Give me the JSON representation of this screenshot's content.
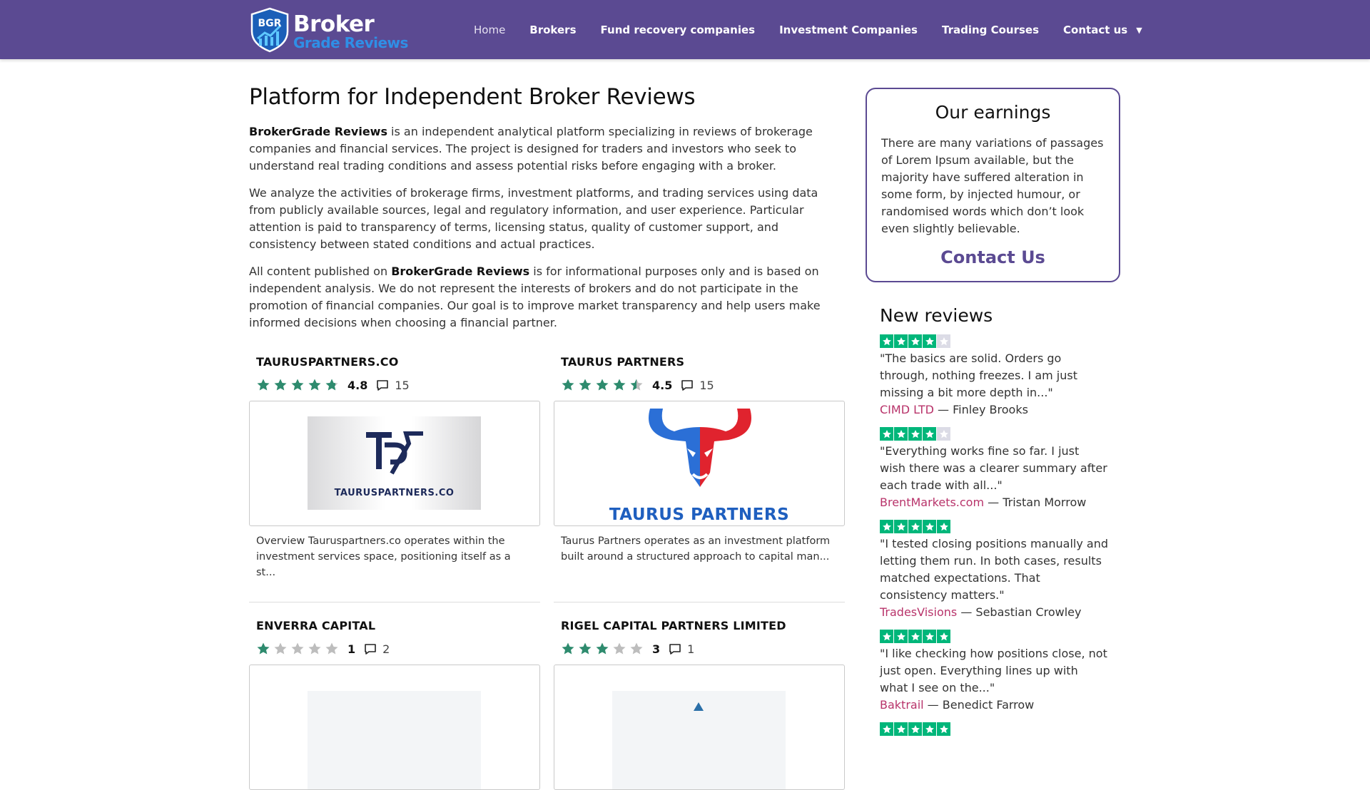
{
  "header": {
    "logo": {
      "badge": "BGR",
      "line1": "Broker",
      "line2": "Grade Reviews"
    },
    "nav": [
      {
        "label": "Home",
        "active": true
      },
      {
        "label": "Brokers"
      },
      {
        "label": "Fund recovery companies"
      },
      {
        "label": "Investment Companies"
      },
      {
        "label": "Trading Courses"
      },
      {
        "label": "Contact us",
        "has_dropdown": true
      }
    ]
  },
  "main": {
    "title": "Platform for Independent Broker Reviews",
    "p1_brand": "BrokerGrade Reviews",
    "p1_rest": " is an independent analytical platform specializing in reviews of brokerage companies and financial services. The project is designed for traders and investors who seek to understand real trading conditions and assess potential risks before engaging with a broker.",
    "p2": "We analyze the activities of brokerage firms, investment platforms, and trading services using data from publicly available sources, legal and regulatory information, and user experience. Particular attention is paid to transparency of terms, licensing status, quality of customer support, and consistency between stated conditions and actual practices.",
    "p3_pre": "All content published on ",
    "p3_brand": "BrokerGrade Reviews",
    "p3_rest": " is for informational purposes only and is based on independent analysis. We do not represent the interests of brokers and do not participate in the promotion of financial companies. Our goal is to improve market transparency and help users make informed decisions when choosing a financial partner.",
    "cards": [
      {
        "name": "TAURUSPARTNERS.CO",
        "rating": 4.8,
        "rating_text": "4.8",
        "comments": "15",
        "logo_text": "TAURUSPARTNERS.CO",
        "logo_mark": "TP",
        "desc": "Overview Tauruspartners.co operates within the investment services space, positioning itself as a st..."
      },
      {
        "name": "TAURUS PARTNERS",
        "rating": 4.5,
        "rating_text": "4.5",
        "comments": "15",
        "logo_text": "TAURUS PARTNERS",
        "desc": "Taurus Partners operates as an investment platform built around a structured approach to capital man..."
      },
      {
        "name": "ENVERRA CAPITAL",
        "rating": 1,
        "rating_text": "1",
        "comments": "2"
      },
      {
        "name": "RIGEL CAPITAL PARTNERS LIMITED",
        "rating": 3,
        "rating_text": "3",
        "comments": "1"
      }
    ]
  },
  "sidebar": {
    "earnings": {
      "title": "Our earnings",
      "text": "There are many variations of passages of Lorem Ipsum available, but the majority have suffered alteration in some form, by injected humour, or randomised words which don’t look even slightly believable.",
      "link": "Contact Us"
    },
    "reviews_title": "New reviews",
    "reviews": [
      {
        "stars": 4,
        "text": "\"The basics are solid. Orders go through, nothing freezes. I am just missing a bit more depth in...\"",
        "broker": "CIMD LTD",
        "author": " — Finley Brooks"
      },
      {
        "stars": 4,
        "text": "\"Everything works fine so far. I just wish there was a clearer summary after each trade with all...\"",
        "broker": "BrentMarkets.com",
        "author": " — Tristan Morrow"
      },
      {
        "stars": 5,
        "text": "\"I tested closing positions manually and letting them run. In both cases, results matched expectations. That consistency matters.\"",
        "broker": "TradesVisions",
        "author": " — Sebastian Crowley"
      },
      {
        "stars": 5,
        "text": "\"I like checking how positions close, not just open. Everything lines up with what I see on the...\"",
        "broker": "Baktrail",
        "author": " — Benedict Farrow"
      },
      {
        "stars": 5
      }
    ]
  },
  "colors": {
    "header_bg": "#5b4a92",
    "star_green": "#2e8b6e",
    "trustpilot_green": "#00b67a",
    "link_pink": "#b8336a",
    "accent": "#5b4a92"
  }
}
